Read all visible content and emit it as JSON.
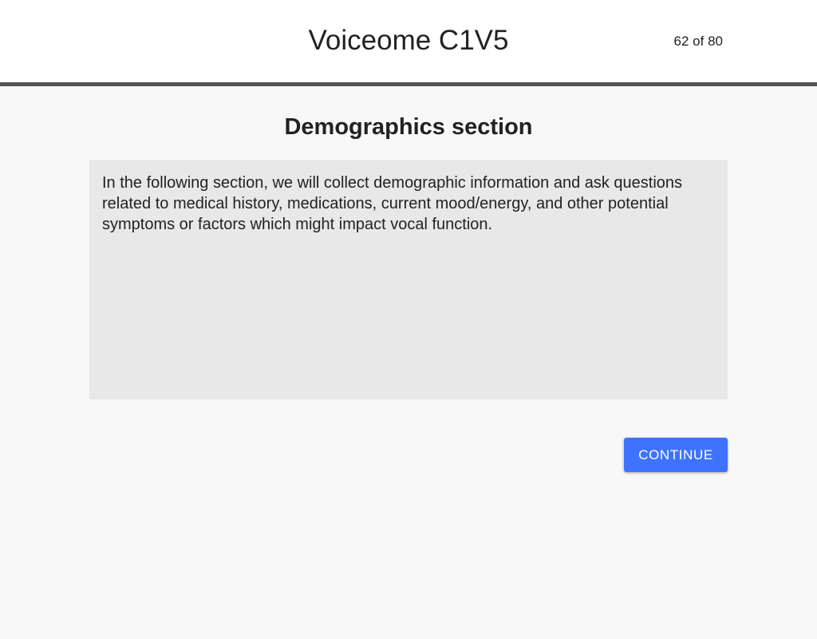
{
  "header": {
    "title": "Voiceome C1V5",
    "progress": "62 of 80"
  },
  "main": {
    "section_title": "Demographics section",
    "description": "In the following section, we will collect demographic information and ask questions related to medical history, medications, current mood/energy, and other potential symptoms or factors which might impact vocal function.",
    "continue_label": "CONTINUE"
  },
  "colors": {
    "header_background": "#ffffff",
    "header_divider": "#555555",
    "page_background": "#f8f8f8",
    "text_box_background": "#e8e8e8",
    "button_accent": "#3f73ff"
  }
}
